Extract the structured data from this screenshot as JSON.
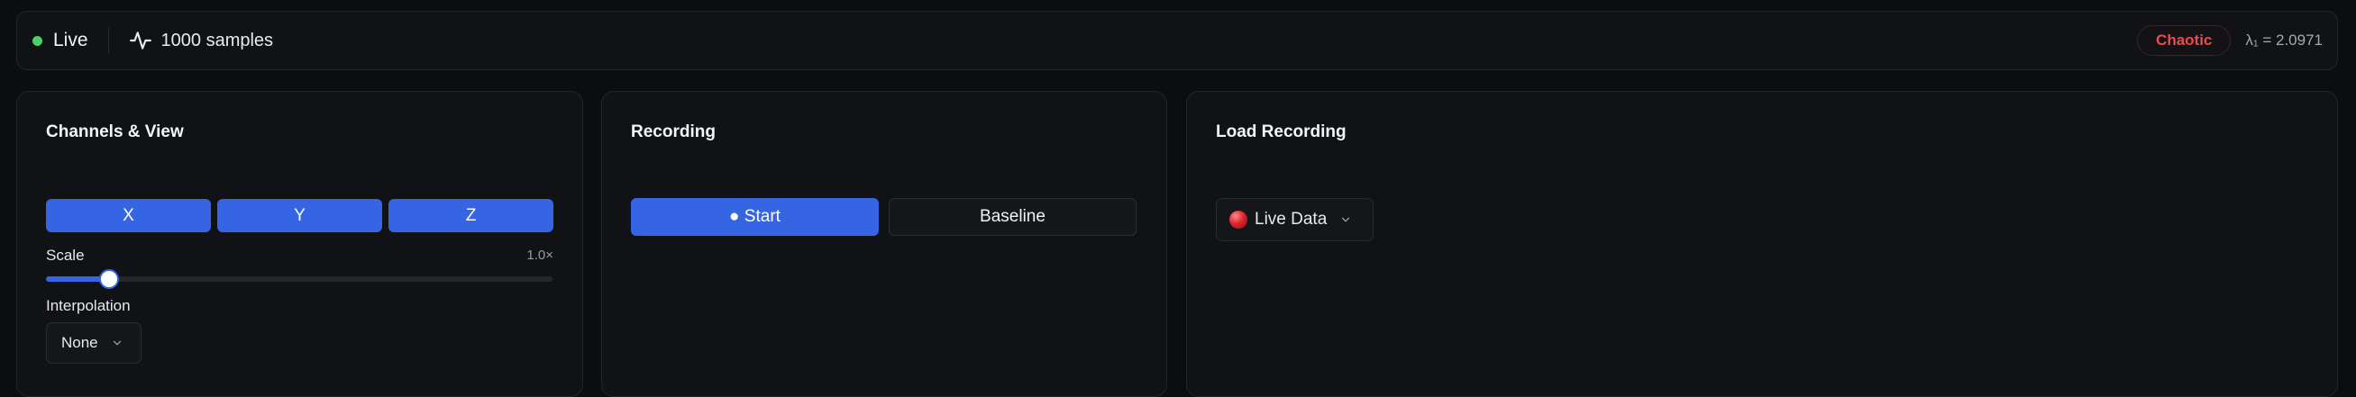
{
  "topbar": {
    "live_label": "Live",
    "samples_label": "1000 samples",
    "status_badge": "Chaotic",
    "lyapunov_label": "λ₁ = 2.0971",
    "live_color": "#4ccf63",
    "status_color": "#ef4a4a"
  },
  "channels_panel": {
    "title": "Channels & View",
    "channels": [
      "X",
      "Y",
      "Z"
    ],
    "scale": {
      "label": "Scale",
      "value_label": "1.0×",
      "fraction": 0.125
    },
    "interpolation": {
      "label": "Interpolation",
      "selected": "None"
    }
  },
  "recording_panel": {
    "title": "Recording",
    "start_label": "● Start",
    "baseline_label": "Baseline"
  },
  "load_panel": {
    "title": "Load Recording",
    "selected": "Live Data"
  },
  "colors": {
    "accent": "#3565e3",
    "background": "#0c0d10",
    "panel": "#111216"
  },
  "icons": {
    "live": "status-dot-icon",
    "samples": "pulse-icon",
    "dropdown": "chevron-down-icon",
    "live_data": "red-circle-icon"
  }
}
